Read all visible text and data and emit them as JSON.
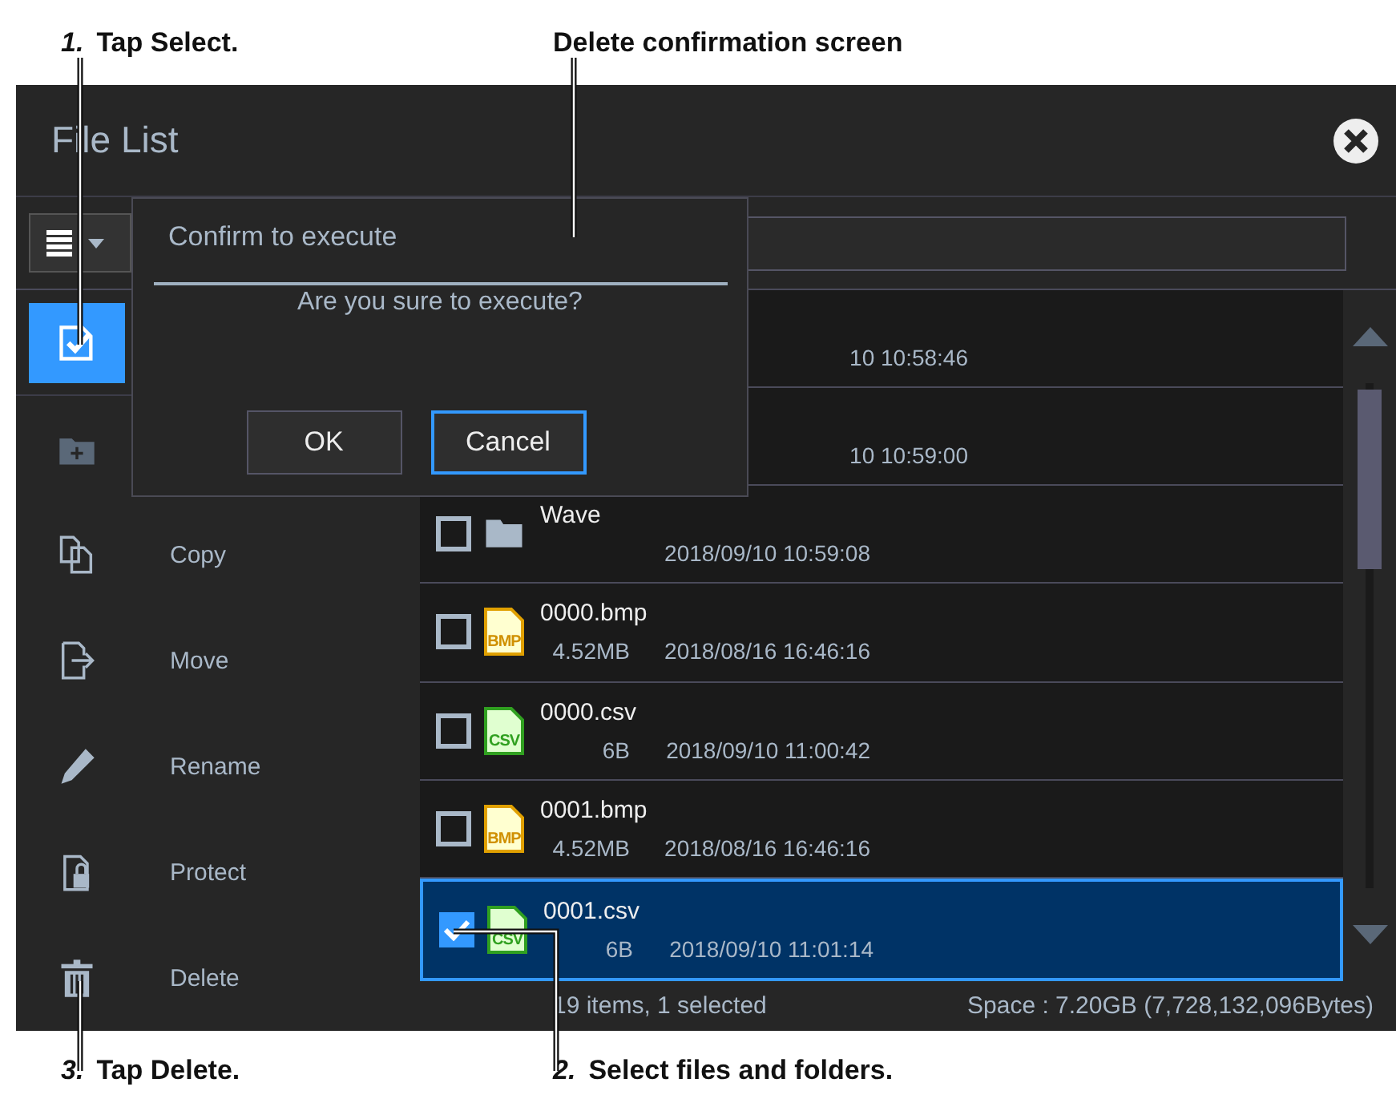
{
  "callouts_top": [
    {
      "number": "1.",
      "text": "Tap Select."
    },
    {
      "text": "Delete confirmation screen"
    }
  ],
  "window": {
    "title": "File List"
  },
  "sidebar": {
    "items": [
      {
        "kind": "select",
        "selected": true
      },
      {
        "kind": "new-folder",
        "selected": false
      },
      {
        "kind": "copy",
        "label": "Copy",
        "selected": false
      },
      {
        "kind": "move",
        "label": "Move",
        "selected": false
      },
      {
        "kind": "rename",
        "label": "Rename",
        "selected": false
      },
      {
        "kind": "protect",
        "label": "Protect",
        "selected": false
      },
      {
        "kind": "delete",
        "label": "Delete",
        "selected": false
      }
    ]
  },
  "files": [
    {
      "kind": "covered",
      "date": "10 10:58:46",
      "selected": false
    },
    {
      "kind": "covered",
      "date": "10 10:59:00",
      "selected": false
    },
    {
      "kind": "folder",
      "name": "Wave",
      "date": "2018/09/10 10:59:08",
      "checked": false,
      "selected": false
    },
    {
      "kind": "bmp",
      "badge": "BMP",
      "name": "0000.bmp",
      "size": "4.52MB",
      "date": "2018/08/16 16:46:16",
      "checked": false,
      "selected": false
    },
    {
      "kind": "csv",
      "badge": "CSV",
      "name": "0000.csv",
      "size": "6B",
      "date": "2018/09/10 11:00:42",
      "checked": false,
      "selected": false
    },
    {
      "kind": "bmp",
      "badge": "BMP",
      "name": "0001.bmp",
      "size": "4.52MB",
      "date": "2018/08/16 16:46:16",
      "checked": false,
      "selected": false
    },
    {
      "kind": "csv",
      "badge": "CSV",
      "name": "0001.csv",
      "size": "6B",
      "date": "2018/09/10 11:01:14",
      "checked": true,
      "selected": true
    }
  ],
  "status_bar": {
    "count": "19 items, 1 selected",
    "space": "Space : 7.20GB (7,728,132,096Bytes)"
  },
  "dialog": {
    "title": "Confirm to execute",
    "message": "Are you sure to execute?",
    "buttons": [
      {
        "label": "OK",
        "focused": false
      },
      {
        "label": "Cancel",
        "focused": true
      }
    ]
  },
  "callouts_bottom": [
    {
      "number": "3.",
      "text": "Tap Delete."
    },
    {
      "number": "2.",
      "text": "Select files and folders."
    }
  ]
}
